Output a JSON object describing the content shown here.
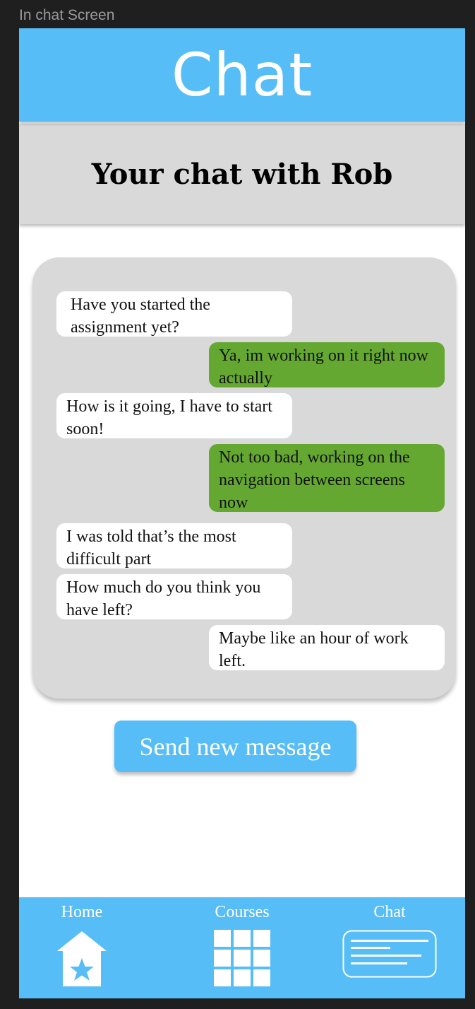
{
  "frame_label": "In chat Screen",
  "header": {
    "title": "Chat"
  },
  "subheader": {
    "title": "Your chat with Rob"
  },
  "messages": [
    {
      "from": "other",
      "text": "Have you started the assignment yet?"
    },
    {
      "from": "me",
      "text": "Ya, im working on it right now actually"
    },
    {
      "from": "other",
      "text": "How is it going, I have to start soon!"
    },
    {
      "from": "me",
      "text": "Not too bad, working on the navigation between screens now"
    },
    {
      "from": "other",
      "text": "I was told that’s the most difficult part"
    },
    {
      "from": "other",
      "text": "How much do you think you have left?"
    },
    {
      "from": "me",
      "text": "Maybe like an hour of work left."
    }
  ],
  "send_button": {
    "label": "Send new message"
  },
  "nav": {
    "items": [
      {
        "label": "Home",
        "icon": "home-star-icon"
      },
      {
        "label": "Courses",
        "icon": "grid-icon"
      },
      {
        "label": "Chat",
        "icon": "chat-lines-icon"
      }
    ]
  },
  "colors": {
    "accent": "#56bdf6",
    "sent_bubble": "#64a832",
    "received_bubble": "#ffffff",
    "panel": "#d9d9d9"
  }
}
